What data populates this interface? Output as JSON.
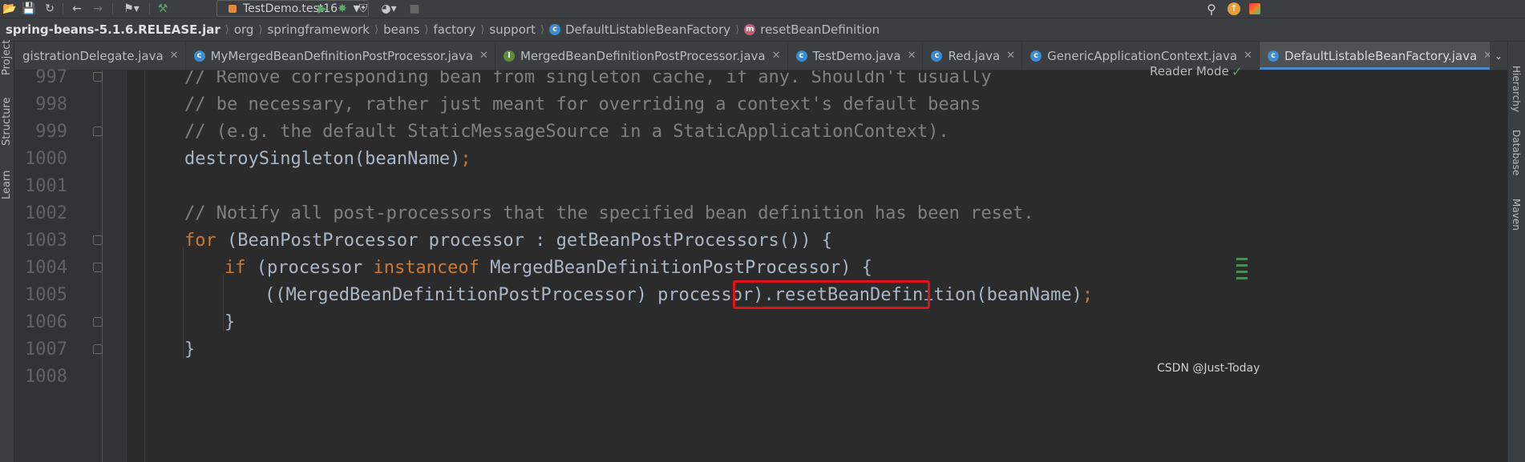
{
  "toolbar": {
    "run_config_label": "TestDemo.test16"
  },
  "breadcrumb": {
    "items": [
      "spring-beans-5.1.6.RELEASE.jar",
      "org",
      "springframework",
      "beans",
      "factory",
      "support",
      "DefaultListableBeanFactory",
      "resetBeanDefinition"
    ]
  },
  "tabs": [
    {
      "label": "gistrationDelegate.java",
      "icon": "class-icon",
      "color": "#3d8bd1"
    },
    {
      "label": "MyMergedBeanDefinitionPostProcessor.java",
      "icon": "class-icon",
      "color": "#3d8bd1"
    },
    {
      "label": "MergedBeanDefinitionPostProcessor.java",
      "icon": "interface-icon",
      "color": "#5e8c3b"
    },
    {
      "label": "TestDemo.java",
      "icon": "class-icon",
      "color": "#3d8bd1"
    },
    {
      "label": "Red.java",
      "icon": "class-icon",
      "color": "#3d8bd1"
    },
    {
      "label": "GenericApplicationContext.java",
      "icon": "class-icon",
      "color": "#3d8bd1"
    },
    {
      "label": "DefaultListableBeanFactory.java",
      "icon": "class-icon",
      "color": "#3d8bd1",
      "active": true
    }
  ],
  "left_tool_windows": [
    "Project",
    "Structure",
    "Learn"
  ],
  "right_tool_windows": [
    "Hierarchy",
    "Database",
    "Maven"
  ],
  "editor": {
    "reader_mode_label": "Reader Mode",
    "line_numbers": [
      "997",
      "998",
      "999",
      "1000",
      "1001",
      "1002",
      "1003",
      "1004",
      "1005",
      "1006",
      "1007",
      "1008"
    ],
    "lines": [
      {
        "comment": "// Remove corresponding bean from singleton cache, if any. Shouldn't usually"
      },
      {
        "comment": "// be necessary, rather just meant for overriding a context's default beans"
      },
      {
        "comment": "// (e.g. the default StaticMessageSource in a StaticApplicationContext)."
      },
      {
        "code": "destroySingleton(beanName)",
        "semi": ";"
      },
      {},
      {
        "comment": "// Notify all post-processors that the specified bean definition has been reset."
      },
      {
        "kw": "for",
        "code": " (BeanPostProcessor processor : getBeanPostProcessors()) {"
      },
      {
        "kw": "if",
        "code1": " (processor ",
        "kw2": "instanceof",
        "code2": " MergedBeanDefinitionPostProcessor) {"
      },
      {
        "code1": "((MergedBeanDefinitionPostProcessor) processor)",
        "code2": ".resetBeanDefinition",
        "code3": "(beanName)",
        "semi": ";"
      },
      {
        "code": "}"
      },
      {
        "code": "}"
      },
      {}
    ]
  },
  "watermark": "CSDN @Just-Today"
}
